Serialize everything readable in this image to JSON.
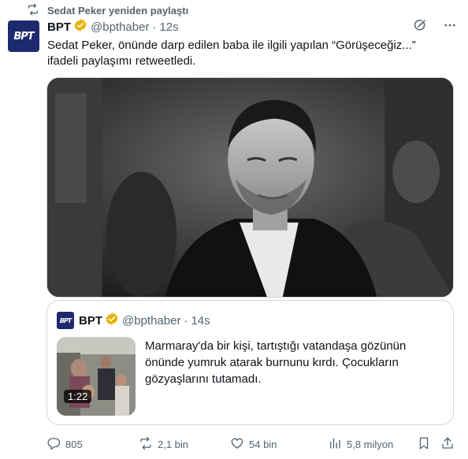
{
  "retweet_notice": "Sedat Peker yeniden paylaştı",
  "tweet": {
    "author_name": "BPT",
    "author_handle": "@bpthaber",
    "separator": "·",
    "time": "12s",
    "text": "Sedat Peker, önünde darp edilen baba ile ilgili yapılan “Görüşeceğiz...” ifadeli paylaşımı retweetledi.",
    "avatar_text": "BPT"
  },
  "quoted_tweet": {
    "author_name": "BPT",
    "author_handle": "@bpthaber",
    "separator": "·",
    "time": "14s",
    "text": "Marmaray'da bir kişi, tartıştığı vatandaşa gözünün önünde yumruk atarak burnunu kırdı. Çocukların gözyaşlarını tutamadı.",
    "video_duration": "1:22",
    "avatar_text": "BPT"
  },
  "actions": {
    "replies": "805",
    "retweets": "2,1 bin",
    "likes": "54 bin",
    "views": "5,8 milyon"
  },
  "colors": {
    "text": "#0f1419",
    "secondary": "#536471",
    "border": "#cfd9de",
    "verified_gold": "#e8b100",
    "avatar_bg": "#1e2a6e"
  },
  "icons": {
    "retweet_notice": "retweet-icon",
    "verified": "gold-verified-badge-icon",
    "grok": "grok-icon",
    "more": "more-horizontal-icon",
    "reply": "reply-icon",
    "retweet": "retweet-icon",
    "like": "heart-icon",
    "views": "views-bar-chart-icon",
    "bookmark": "bookmark-icon",
    "share": "share-icon"
  }
}
